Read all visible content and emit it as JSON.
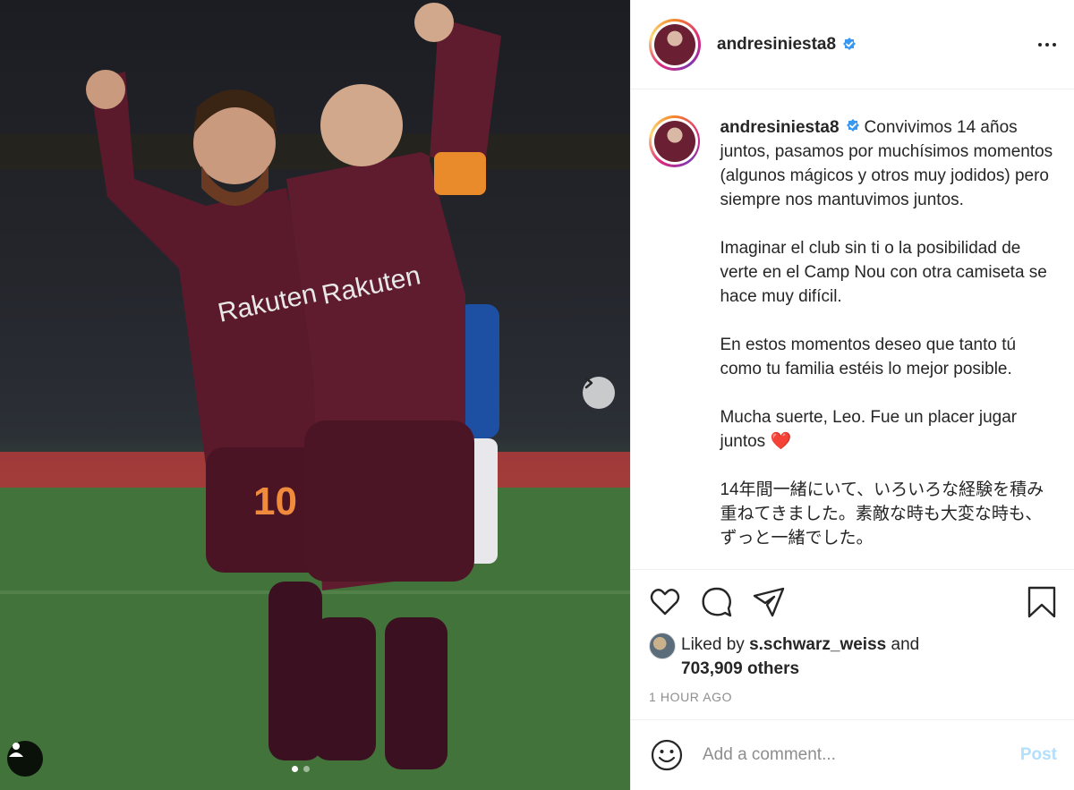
{
  "post": {
    "username": "andresiniesta8",
    "verified": true,
    "caption": "Convivimos 14 años juntos, pasamos por muchísimos momentos (algunos mágicos y otros muy jodidos) pero siempre nos mantuvimos juntos.\n\nImaginar el club sin ti o la posibilidad de verte en el Camp Nou con otra camiseta se hace muy difícil.\n\nEn estos momentos deseo que tanto tú como tu familia estéis lo mejor posible.\n\nMucha suerte, Leo. Fue un placer jugar juntos ❤️\n\n14年間一緒にいて、いろいろな経験を積み重ねてきました。素敵な時も大変な時も、ずっと一緒でした。",
    "likes": {
      "prefix": "Liked by",
      "user": "s.schwarz_weiss",
      "conjunction": "and",
      "others": "703,909 others"
    },
    "time": "1 HOUR AGO"
  },
  "comment": {
    "placeholder": "Add a comment...",
    "post_label": "Post"
  },
  "icons": {
    "more": "more-options-icon",
    "like": "heart-icon",
    "comment": "comment-icon",
    "share": "share-icon",
    "save": "bookmark-icon",
    "emoji": "emoji-icon",
    "next": "chevron-right-icon",
    "tag": "user-tag-icon"
  },
  "colors": {
    "verified": "#3897f0",
    "post_button": "#b2dffc",
    "muted": "#8e8e8e",
    "jersey": "#5a1a2b"
  }
}
